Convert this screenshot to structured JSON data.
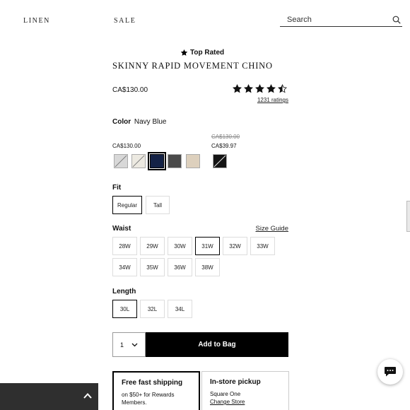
{
  "nav": {
    "links": [
      "LINEN",
      "SALE"
    ],
    "search_placeholder": "Search"
  },
  "product": {
    "badge": "Top Rated",
    "title": "SKINNY RAPID MOVEMENT CHINO",
    "price": "CA$130.00",
    "rating_value": 4.5,
    "ratings_count": "1231 ratings"
  },
  "color": {
    "label": "Color",
    "selected": "Navy Blue",
    "regular_price": "CA$130.00",
    "sale_old_price": "CA$130.00",
    "sale_price": "CA$39.97",
    "swatches": [
      {
        "hex": "#d8d8d8",
        "name": "light-grey",
        "unavailable": true,
        "selected": false
      },
      {
        "hex": "#ece9e1",
        "name": "stone",
        "unavailable": true,
        "selected": false
      },
      {
        "hex": "#142246",
        "name": "navy-blue",
        "unavailable": false,
        "selected": true
      },
      {
        "hex": "#4a4a4a",
        "name": "charcoal",
        "unavailable": false,
        "selected": false
      },
      {
        "hex": "#ddd0bd",
        "name": "khaki",
        "unavailable": false,
        "selected": false
      },
      {
        "hex": "#141414",
        "name": "black",
        "unavailable": true,
        "selected": false
      }
    ]
  },
  "fit": {
    "label": "Fit",
    "options": [
      "Regular",
      "Tall"
    ],
    "selected": "Regular"
  },
  "waist": {
    "label": "Waist",
    "size_guide": "Size Guide",
    "options": [
      "28W",
      "29W",
      "30W",
      "31W",
      "32W",
      "33W",
      "34W",
      "35W",
      "36W",
      "38W"
    ],
    "selected": "31W"
  },
  "length": {
    "label": "Length",
    "options": [
      "30L",
      "32L",
      "34L"
    ],
    "selected": "30L"
  },
  "cart": {
    "quantity": "1",
    "add_label": "Add to Bag"
  },
  "shipping": {
    "title": "Free fast shipping",
    "text": "on $50+ for Rewards Members."
  },
  "pickup": {
    "title": "In-store pickup",
    "store": "Square One",
    "change": "Change Store"
  },
  "colors": {
    "accent": "#000000",
    "bottom_bar": "#2f2f2f"
  }
}
